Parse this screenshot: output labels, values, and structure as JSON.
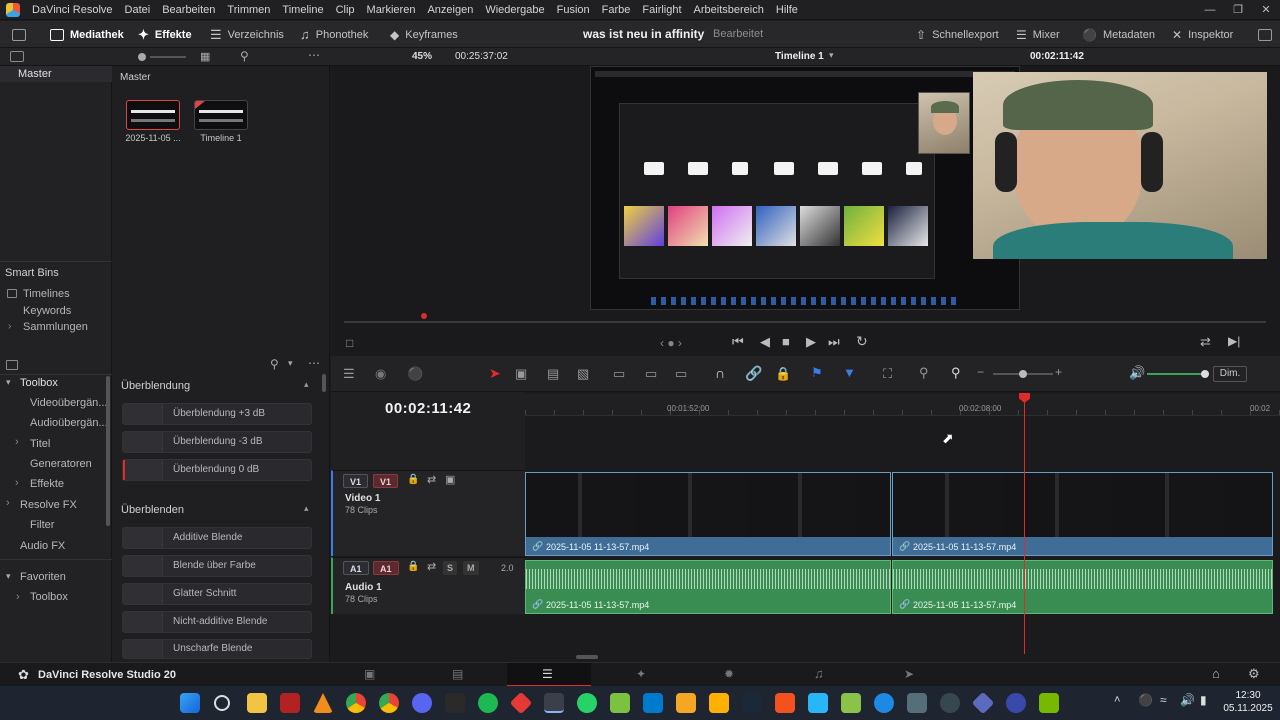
{
  "menu": {
    "items": [
      "DaVinci Resolve",
      "Datei",
      "Bearbeiten",
      "Trimmen",
      "Timeline",
      "Clip",
      "Markieren",
      "Anzeigen",
      "Wiedergabe",
      "Fusion",
      "Farbe",
      "Fairlight",
      "Arbeitsbereich",
      "Hilfe"
    ]
  },
  "toolbar": {
    "mediathek": "Mediathek",
    "effekte": "Effekte",
    "verzeichnis": "Verzeichnis",
    "phonothek": "Phonothek",
    "keyframes": "Keyframes",
    "project_title": "was ist neu in affinity",
    "project_status": "Bearbeitet",
    "schnellexport": "Schnellexport",
    "mixer": "Mixer",
    "metadaten": "Metadaten",
    "inspektor": "Inspektor"
  },
  "viewer": {
    "zoom": "45%",
    "source_timecode": "00:25:37:02",
    "timeline_name": "Timeline 1",
    "record_timecode": "00:02:11:42"
  },
  "media_pool": {
    "root": "Master",
    "header": "Master",
    "clips": [
      {
        "name": "2025-11-05 ..."
      },
      {
        "name": "Timeline 1"
      }
    ],
    "smart_bins_title": "Smart Bins",
    "smart_bins": [
      "Timelines",
      "Keywords",
      "Sammlungen"
    ]
  },
  "effects": {
    "tree": {
      "toolbox": "Toolbox",
      "items": [
        "Videoübergän...",
        "Audioübergän...",
        "Titel",
        "Generatoren",
        "Effekte",
        "Resolve FX",
        "Filter",
        "Audio FX"
      ],
      "favoriten": "Favoriten",
      "fav_toolbox": "Toolbox"
    },
    "group1_title": "Überblendung",
    "group1": [
      "Überblendung +3 dB",
      "Überblendung -3 dB",
      "Überblendung 0 dB"
    ],
    "group2_title": "Überblenden",
    "group2": [
      "Additive Blende",
      "Blende über Farbe",
      "Glatter Schnitt",
      "Nicht-additive Blende",
      "Unscharfe Blende"
    ]
  },
  "timeline": {
    "timecode": "00:02:11:42",
    "ruler": [
      "00:01:52:00",
      "00:02:08:00",
      "00:02"
    ],
    "dim_label": "Dim.",
    "video_track": {
      "tag1": "V1",
      "tag2": "V1",
      "name": "Video 1",
      "clips": "78 Clips"
    },
    "audio_track": {
      "tag1": "A1",
      "tag2": "A1",
      "name": "Audio 1",
      "clips": "78 Clips",
      "solo": "S",
      "mute": "M",
      "level": "2.0"
    },
    "video_clip_a": "2025-11-05 11-13-57.mp4",
    "video_clip_b": "2025-11-05 11-13-57.mp4",
    "audio_clip_a": "2025-11-05 11-13-57.mp4",
    "audio_clip_b": "2025-11-05 11-13-57.mp4"
  },
  "pagebar": {
    "brand": "DaVinci Resolve Studio 20"
  },
  "taskbar": {
    "time": "12:30",
    "date": "05.11.2025"
  },
  "colors": {
    "accent_red": "#e02b2b",
    "video_clip": "#3f6d96",
    "audio_clip": "#3a8d52",
    "tag_blue": "#3a3a5c"
  }
}
